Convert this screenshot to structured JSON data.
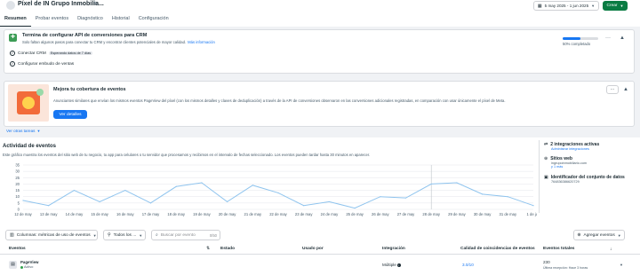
{
  "header": {
    "title": "Píxel de IN Grupo Inmobilia...",
    "date_range": "5 may 2025 - 1 jun 2025",
    "create_label": "Crear",
    "tabs": [
      "Resumen",
      "Probar eventos",
      "Diagnóstico",
      "Historial",
      "Configuración"
    ]
  },
  "setup_card": {
    "title": "Termina de configurar API de conversiones para CRM",
    "subtitle": "Solo faltan algunos pasos para conectar tu CRM y encontrar clientes potenciales de mayor calidad.",
    "more_info": "Más información",
    "progress_label": "50% completado",
    "progress": 0.5,
    "steps": [
      {
        "label": "Conectar CRM",
        "badge": "Esperando datos de 7 días"
      },
      {
        "label": "Configurar embudo de ventas",
        "badge": ""
      }
    ]
  },
  "promo_card": {
    "title": "Mejora tu cobertura de eventos",
    "body": "Anunciantes similares que envían los mismos eventos PageView del píxel (con los mismos detalles y claves de deduplicación) a través de la API de conversiones observaron en las conversiones adicionales registradas, en comparación con usar únicamente el píxel de Meta.",
    "button": "Ver detalles"
  },
  "see_more": "Ver otras tareas",
  "activity": {
    "title": "Actividad de eventos",
    "description": "Este gráfico muestra los eventos del sitio web de tu negocio, tu app para celulares o tu servidor que procesamos y recibimos en el intervalo de fechas seleccionado. Los eventos pueden tardar hasta 30 minutos en aparecer."
  },
  "chart_data": {
    "type": "line",
    "x": [
      "12 de may",
      "13 de may",
      "14 de may",
      "15 de may",
      "16 de may",
      "17 de may",
      "18 de may",
      "19 de may",
      "20 de may",
      "21 de may",
      "22 de may",
      "23 de may",
      "24 de may",
      "25 de may",
      "26 de may",
      "27 de may",
      "28 de may",
      "29 de may",
      "30 de may",
      "31 de may",
      "1 de jun"
    ],
    "y": [
      7,
      3,
      15,
      6,
      15,
      5,
      18,
      21,
      6,
      19,
      13,
      3,
      6,
      1,
      10,
      9,
      20,
      21,
      12,
      10,
      3
    ],
    "yticks": [
      0,
      5,
      10,
      15,
      20,
      25,
      30,
      35
    ],
    "ylim": [
      0,
      35
    ],
    "series_color": "#8fc4ee",
    "grid": true
  },
  "side_panel": {
    "integrations_title": "2 integraciones activas",
    "integrations_link": "Administrar integraciones",
    "websites_title": "Sitios web",
    "website_url": "ingrupoinmobiliario.com",
    "website_more": "y 1 más",
    "dataset_title": "Identificador del conjunto de datos",
    "dataset_id": "764836386620729"
  },
  "filters": {
    "columns": "Columnas: métricas de uso de eventos",
    "all": "Todos los ...",
    "search_placeholder": "Buscar por evento",
    "search_count": "0/50",
    "add_events": "Agregar eventos"
  },
  "table": {
    "headers": [
      "Eventos",
      "Estado",
      "Usado por",
      "Integración",
      "Calidad de coincidencias de eventos",
      "Eventos totales"
    ],
    "rows": [
      {
        "event": "PageView",
        "status_text": "Activo",
        "integration": "Múltiple",
        "quality": "3.0/10",
        "total": "230",
        "total_sub": "Última recepción: Hace 3 horas"
      }
    ]
  },
  "colors": {
    "accent": "#1877f2",
    "primary_green": "#0a7c43",
    "active_green": "#31a24c"
  }
}
